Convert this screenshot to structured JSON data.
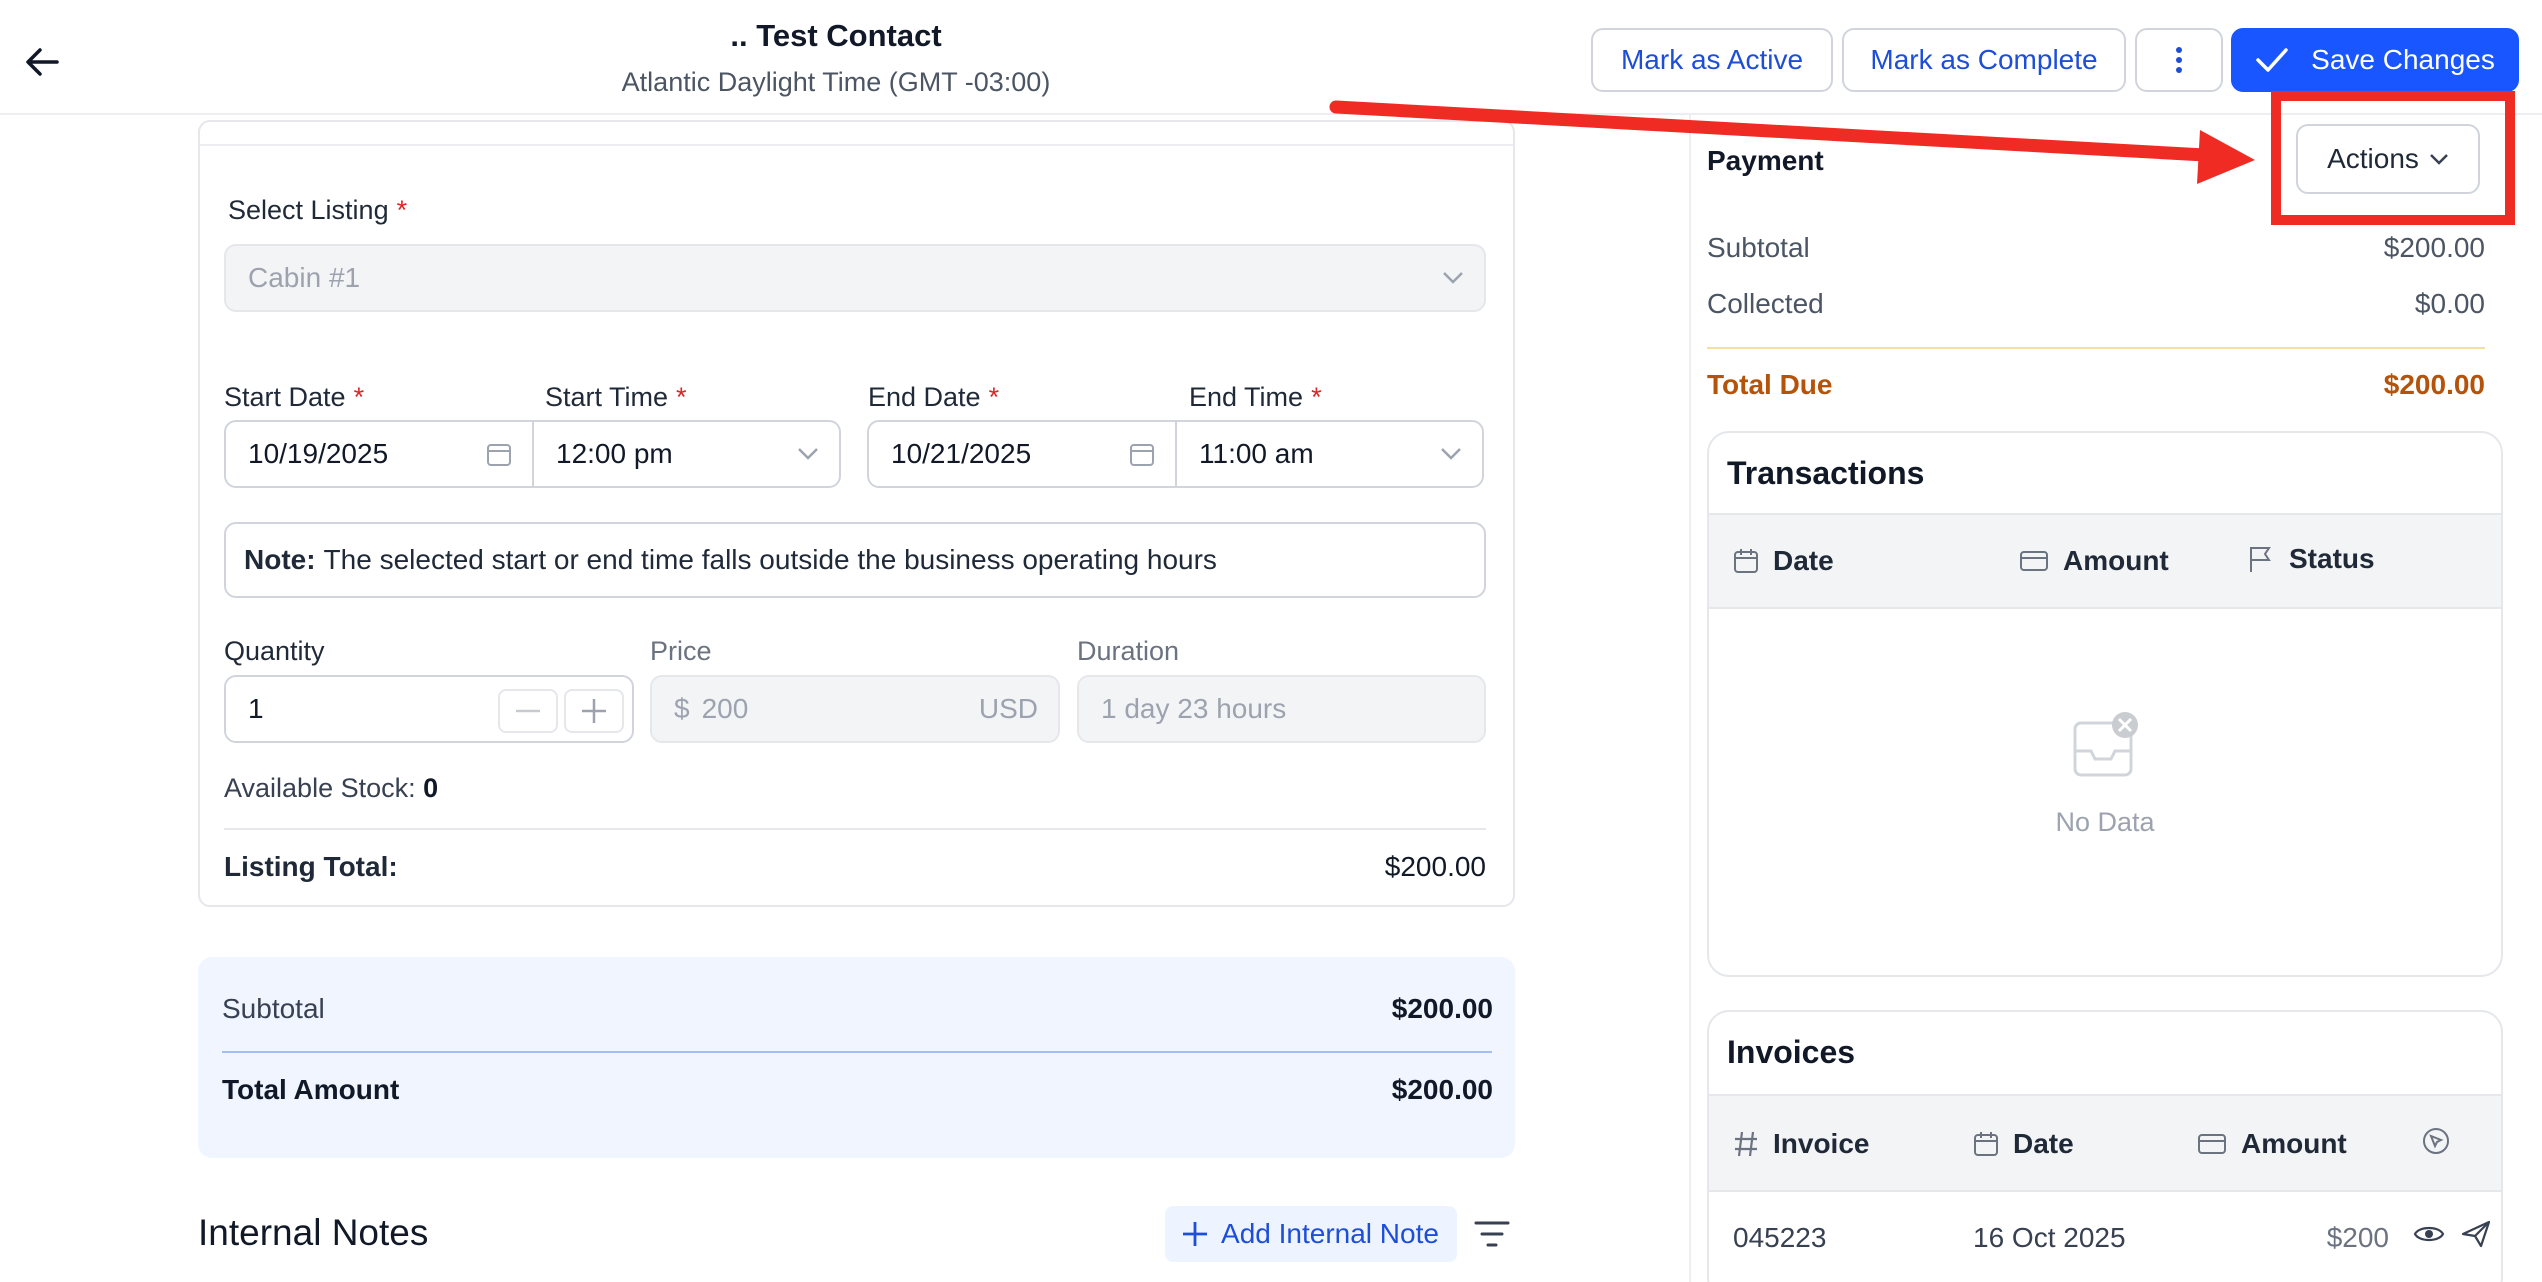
{
  "header": {
    "title": ".. Test Contact",
    "subtitle": "Atlantic Daylight Time (GMT -03:00)",
    "mark_active": "Mark as Active",
    "mark_complete": "Mark as Complete",
    "more_icon": "more-vertical-icon",
    "save": "Save Changes"
  },
  "listing": {
    "select_label": "Select Listing",
    "select_placeholder": "Cabin #1",
    "start_date_label": "Start Date",
    "start_date": "10/19/2025",
    "start_time_label": "Start Time",
    "start_time": "12:00 pm",
    "end_date_label": "End Date",
    "end_date": "10/21/2025",
    "end_time_label": "End Time",
    "end_time": "11:00 am",
    "required_mark": "*",
    "note_label": "Note:",
    "note_text": "The selected start or end time falls outside the business operating hours",
    "quantity_label": "Quantity",
    "quantity": "1",
    "price_label": "Price",
    "price_symbol": "$",
    "price": "200",
    "price_currency": "USD",
    "duration_label": "Duration",
    "duration_placeholder": "1 day 23 hours",
    "stock_label": "Available Stock:",
    "stock_value": "0",
    "total_label": "Listing Total:",
    "total_value": "$200.00"
  },
  "summary": {
    "subtotal_label": "Subtotal",
    "subtotal": "$200.00",
    "total_label": "Total Amount",
    "total": "$200.00"
  },
  "notes": {
    "title": "Internal Notes",
    "add_label": "Add Internal Note",
    "filter_icon": "filter-icon"
  },
  "payment": {
    "title": "Payment",
    "actions_label": "Actions",
    "subtotal_label": "Subtotal",
    "subtotal": "$200.00",
    "collected_label": "Collected",
    "collected": "$0.00",
    "due_label": "Total Due",
    "due": "$200.00"
  },
  "transactions": {
    "title": "Transactions",
    "columns": [
      "Date",
      "Amount",
      "Status"
    ],
    "empty_text": "No Data"
  },
  "invoices": {
    "title": "Invoices",
    "columns": [
      "Invoice",
      "Date",
      "Amount"
    ],
    "rows": [
      {
        "invoice": "045223",
        "date": "16 Oct 2025",
        "amount": "$200"
      }
    ]
  },
  "colors": {
    "primary": "#1a56ff",
    "link": "#1d4ed8",
    "due": "#b45309",
    "annotation": "#ef2b24"
  }
}
